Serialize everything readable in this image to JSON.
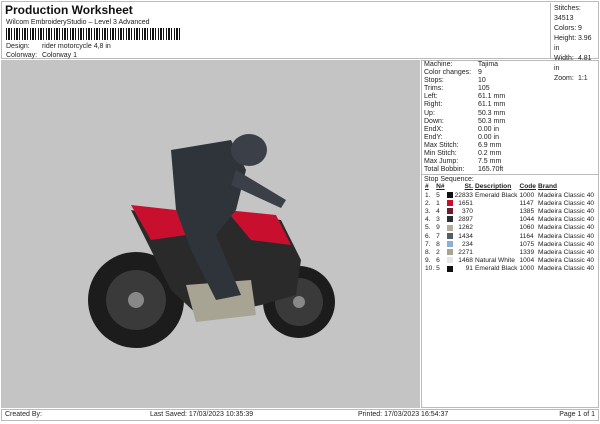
{
  "header": {
    "title": "Production Worksheet",
    "subtitle": "Wilcom EmbroideryStudio – Level 3 Advanced",
    "design_label": "Design:",
    "design": "rider motorcycle 4,8 in",
    "colorway_label": "Colorway:",
    "colorway": "Colorway 1"
  },
  "stats": [
    {
      "l": "Stitches:",
      "v": "34513"
    },
    {
      "l": "Colors:",
      "v": "9"
    },
    {
      "l": "Height:",
      "v": "3.96 in"
    },
    {
      "l": "Width:",
      "v": "4.81 in"
    },
    {
      "l": "Zoom:",
      "v": "1:1"
    }
  ],
  "details": [
    {
      "l": "Machine:",
      "v": "Tajima"
    },
    {
      "l": "Color changes:",
      "v": "9"
    },
    {
      "l": "Stops:",
      "v": "10"
    },
    {
      "l": "Trims:",
      "v": "105"
    },
    {
      "l": "Left:",
      "v": "61.1 mm"
    },
    {
      "l": "Right:",
      "v": "61.1 mm"
    },
    {
      "l": "Up:",
      "v": "50.3 mm"
    },
    {
      "l": "Down:",
      "v": "50.3 mm"
    },
    {
      "l": "EndX:",
      "v": "0.00 in"
    },
    {
      "l": "EndY:",
      "v": "0.00 in"
    },
    {
      "l": "Max Stitch:",
      "v": "6.9 mm"
    },
    {
      "l": "Min Stitch:",
      "v": "0.2 mm"
    },
    {
      "l": "Max Jump:",
      "v": "7.5 mm"
    },
    {
      "l": "Total Bobbin:",
      "v": "165.70ft"
    }
  ],
  "sequence": {
    "title": "Stop Sequence:",
    "headers": [
      "#",
      "N#",
      "St.",
      "Description",
      "Code",
      "Brand"
    ],
    "rows": [
      {
        "i": "1.",
        "n": "5",
        "color": "#111111",
        "st": "22833",
        "desc": "Emerald Black",
        "code": "1000",
        "brand": "Madeira Classic 40"
      },
      {
        "i": "2.",
        "n": "1",
        "color": "#c8102e",
        "st": "1651",
        "desc": "",
        "code": "1147",
        "brand": "Madeira Classic 40"
      },
      {
        "i": "3.",
        "n": "4",
        "color": "#6b1e2e",
        "st": "370",
        "desc": "",
        "code": "1385",
        "brand": "Madeira Classic 40"
      },
      {
        "i": "4.",
        "n": "3",
        "color": "#2a2f3a",
        "st": "2897",
        "desc": "",
        "code": "1044",
        "brand": "Madeira Classic 40"
      },
      {
        "i": "5.",
        "n": "9",
        "color": "#b8aa9a",
        "st": "1262",
        "desc": "",
        "code": "1060",
        "brand": "Madeira Classic 40"
      },
      {
        "i": "6.",
        "n": "7",
        "color": "#555d66",
        "st": "1434",
        "desc": "",
        "code": "1164",
        "brand": "Madeira Classic 40"
      },
      {
        "i": "7.",
        "n": "8",
        "color": "#8ab0d6",
        "st": "234",
        "desc": "",
        "code": "1075",
        "brand": "Madeira Classic 40"
      },
      {
        "i": "8.",
        "n": "2",
        "color": "#a8a494",
        "st": "2271",
        "desc": "",
        "code": "1339",
        "brand": "Madeira Classic 40"
      },
      {
        "i": "9.",
        "n": "6",
        "color": "#e6e6ea",
        "st": "1468",
        "desc": "Natural White",
        "code": "1004",
        "brand": "Madeira Classic 40"
      },
      {
        "i": "10.",
        "n": "5",
        "color": "#111111",
        "st": "91",
        "desc": "Emerald Black",
        "code": "1000",
        "brand": "Madeira Classic 40"
      }
    ]
  },
  "footer": {
    "created": "Created By:",
    "saved": "Last Saved: 17/03/2023 10:35:39",
    "printed": "Printed: 17/03/2023 16:54:37",
    "page": "Page 1 of 1"
  }
}
